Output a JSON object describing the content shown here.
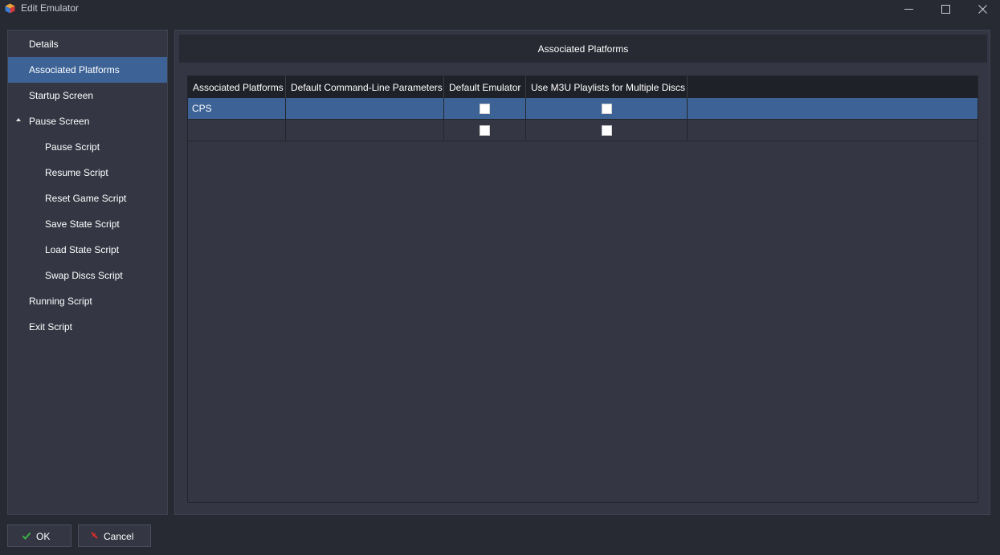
{
  "window": {
    "title": "Edit Emulator",
    "icon": "launchbox-cube-icon",
    "controls": [
      "minimize-icon",
      "maximize-icon",
      "close-icon"
    ]
  },
  "sidebar": {
    "items": [
      {
        "label": "Details",
        "selected": false,
        "level": 0
      },
      {
        "label": "Associated Platforms",
        "selected": true,
        "level": 0
      },
      {
        "label": "Startup Screen",
        "selected": false,
        "level": 0
      },
      {
        "label": "Pause Screen",
        "selected": false,
        "level": 0,
        "expanded": true
      },
      {
        "label": "Pause Script",
        "selected": false,
        "level": 1
      },
      {
        "label": "Resume Script",
        "selected": false,
        "level": 1
      },
      {
        "label": "Reset Game Script",
        "selected": false,
        "level": 1
      },
      {
        "label": "Save State Script",
        "selected": false,
        "level": 1
      },
      {
        "label": "Load State Script",
        "selected": false,
        "level": 1
      },
      {
        "label": "Swap Discs Script",
        "selected": false,
        "level": 1
      },
      {
        "label": "Running Script",
        "selected": false,
        "level": 0
      },
      {
        "label": "Exit Script",
        "selected": false,
        "level": 0
      }
    ]
  },
  "main": {
    "header": "Associated Platforms",
    "table": {
      "columns": [
        "Associated Platforms",
        "Default Command-Line Parameters",
        "Default Emulator",
        "Use M3U Playlists for Multiple Discs"
      ],
      "rows": [
        {
          "platform": "CPS",
          "params": "",
          "default_emulator": false,
          "use_m3u": false,
          "selected": true
        },
        {
          "platform": "",
          "params": "",
          "default_emulator": false,
          "use_m3u": false,
          "selected": false
        }
      ]
    }
  },
  "footer": {
    "ok_label": "OK",
    "cancel_label": "Cancel",
    "ok_icon": "checkmark-icon",
    "cancel_icon": "x-icon"
  },
  "colors": {
    "background": "#272a33",
    "panel": "#343743",
    "selection": "#3d6396",
    "ok_accent": "#3cb043",
    "cancel_accent": "#e02a2a"
  }
}
